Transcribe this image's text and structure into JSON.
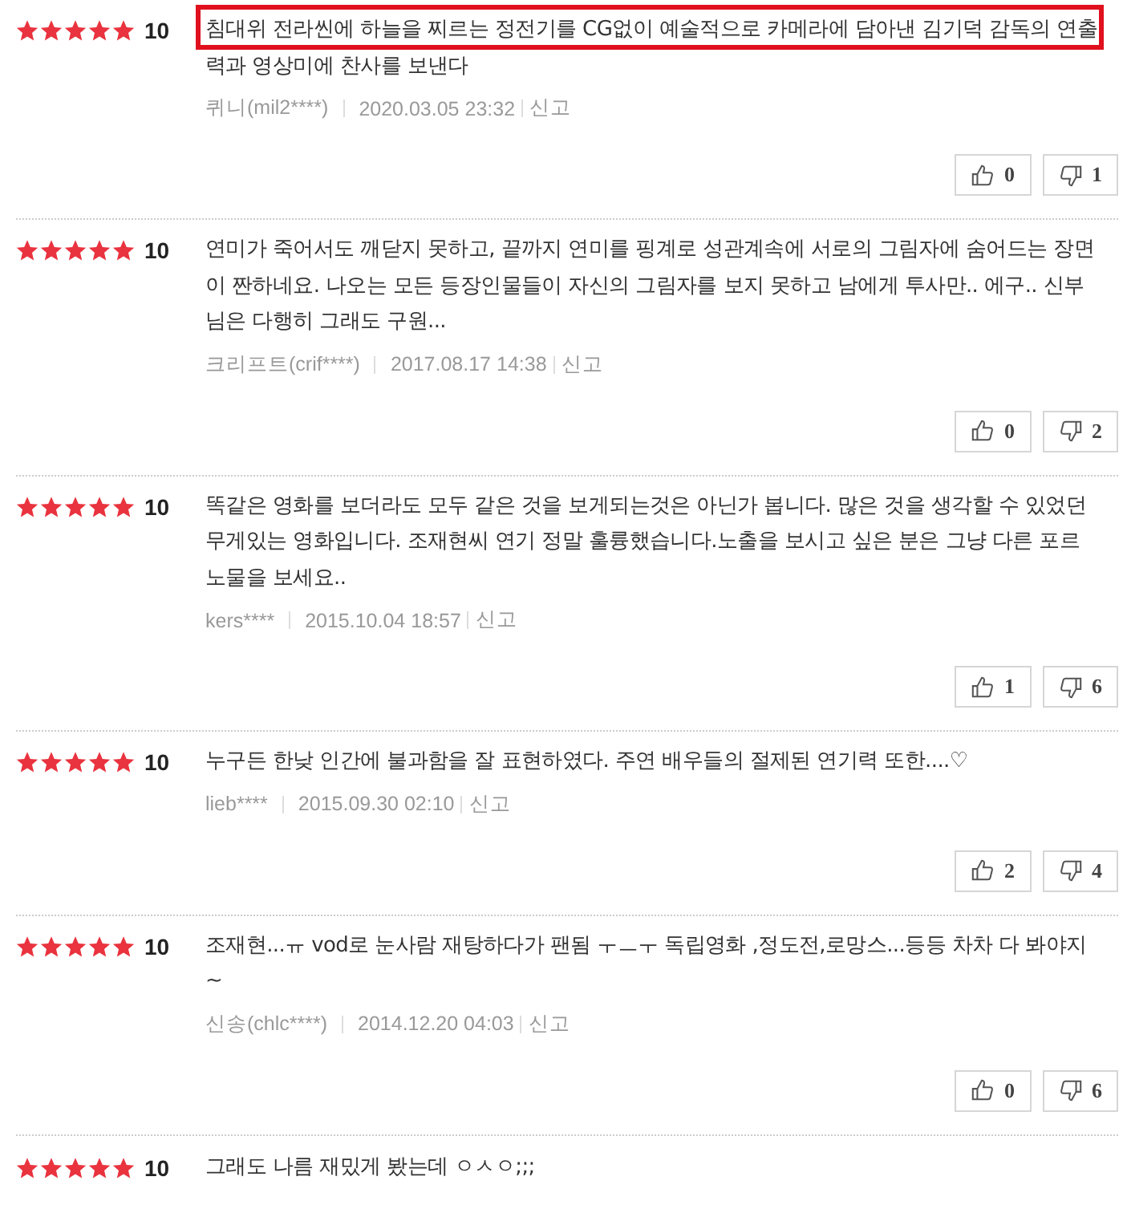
{
  "reviews": [
    {
      "stars": 5,
      "score": "10",
      "highlighted": true,
      "text": "침대위 전라씬에 하늘을 찌르는 정전기를 CG없이 예술적으로 카메라에 담아낸 김기덕 감독의 연출력과 영상미에 찬사를 보낸다",
      "author": "퀴니(mil2****)",
      "date": "2020.03.05 23:32",
      "report": "신고",
      "likes": "0",
      "dislikes": "1"
    },
    {
      "stars": 5,
      "score": "10",
      "highlighted": false,
      "text": "연미가 죽어서도 깨닫지 못하고, 끝까지 연미를 핑계로 성관계속에 서로의 그림자에 숨어드는 장면이 짠하네요. 나오는 모든 등장인물들이 자신의 그림자를 보지 못하고 남에게 투사만.. 에구.. 신부님은 다행히 그래도 구원...",
      "author": "크리프트(crif****)",
      "date": "2017.08.17 14:38",
      "report": "신고",
      "likes": "0",
      "dislikes": "2"
    },
    {
      "stars": 5,
      "score": "10",
      "highlighted": false,
      "text": "똑같은 영화를 보더라도 모두 같은 것을 보게되는것은 아닌가 봅니다. 많은 것을 생각할 수 있었던 무게있는 영화입니다. 조재현씨 연기 정말 훌륭했습니다.노출을 보시고 싶은 분은 그냥 다른 포르노물을 보세요..",
      "author": "kers****",
      "date": "2015.10.04 18:57",
      "report": "신고",
      "likes": "1",
      "dislikes": "6"
    },
    {
      "stars": 5,
      "score": "10",
      "highlighted": false,
      "text": "누구든 한낮 인간에 불과함을 잘 표현하였다. 주연 배우들의 절제된 연기력 또한....♡",
      "author": "lieb****",
      "date": "2015.09.30 02:10",
      "report": "신고",
      "likes": "2",
      "dislikes": "4"
    },
    {
      "stars": 5,
      "score": "10",
      "highlighted": false,
      "text": "조재현...ㅠ vod로 눈사람 재탕하다가 팬됨 ㅜㅡㅜ 독립영화 ,정도전,로망스...등등 차차 다 봐야지~",
      "author": "신송(chlc****)",
      "date": "2014.12.20 04:03",
      "report": "신고",
      "likes": "0",
      "dislikes": "6"
    },
    {
      "stars": 5,
      "score": "10",
      "highlighted": false,
      "text": "그래도 나름 재밌게 봤는데 ㅇㅅㅇ;;;"
    }
  ]
}
